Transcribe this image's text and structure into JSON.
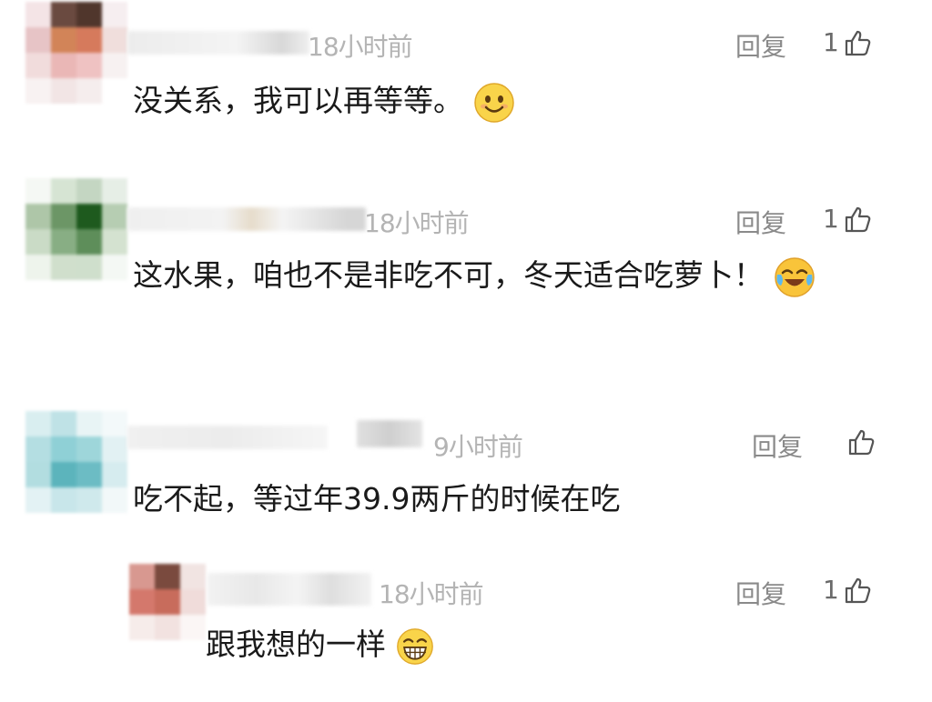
{
  "comments": [
    {
      "time": "18小时前",
      "reply_label": "回复",
      "likes": "1",
      "text": "没关系，我可以再等等。",
      "emoji": "smile-emoji",
      "avatar_colors": [
        "#f4e4e6",
        "#6a4a40",
        "#50362c",
        "#f6eef0",
        "#e7c4c6",
        "#d28458",
        "#d67a5c",
        "#f0dedc",
        "#f1dcdc",
        "#eab7b6",
        "#efc2c2",
        "#f7f1f1",
        "#f8f2f2",
        "#f2e5e5",
        "#f5eded",
        "#ffffff"
      ]
    },
    {
      "time": "18小时前",
      "reply_label": "回复",
      "likes": "1",
      "text": "这水果，咱也不是非吃不可，冬天适合吃萝卜！",
      "emoji": "laugh-cry-emoji",
      "avatar_colors": [
        "#f5f8f4",
        "#d6e4d3",
        "#c4d6c2",
        "#e6eee6",
        "#aec6a8",
        "#6c9666",
        "#1e5a1e",
        "#b6cdb2",
        "#cadbc6",
        "#88ae84",
        "#5e8e5a",
        "#d4e2d0",
        "#eef4ec",
        "#d0dfcc",
        "#cfdfcc",
        "#f4f8f4"
      ]
    },
    {
      "time": "9小时前",
      "reply_label": "回复",
      "likes": "",
      "text": "吃不起，等过年39.9两斤的时候在吃",
      "emoji": "",
      "avatar_colors": [
        "#d9eef0",
        "#bfe2e6",
        "#e8f4f5",
        "#f3f9fa",
        "#b4dee2",
        "#8fd0d6",
        "#9ed6da",
        "#e2f1f3",
        "#b2dde0",
        "#5cb4bc",
        "#6cbcc4",
        "#d6ecef",
        "#e3f2f4",
        "#c8e6ea",
        "#cfe9ec",
        "#f2f8f9"
      ]
    }
  ],
  "reply": {
    "time": "18小时前",
    "reply_label": "回复",
    "likes": "1",
    "text": "跟我想的一样",
    "emoji": "grin-emoji",
    "avatar_colors": [
      "#d89890",
      "#7a4a3e",
      "#f1e4e2",
      "#d4786c",
      "#c86c5c",
      "#f0dcda",
      "#f6ecea",
      "#f2e2e0",
      "#fbf6f5"
    ]
  }
}
